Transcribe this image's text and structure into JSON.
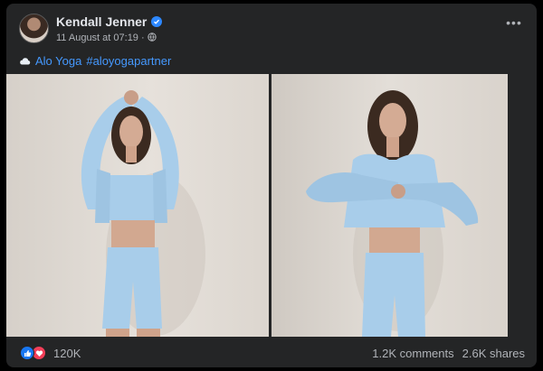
{
  "post": {
    "author": "Kendall Jenner",
    "timestamp": "11 August at 07:19",
    "separator": "·",
    "more_label": "•••",
    "caption_brand": "Alo Yoga",
    "caption_hashtag": "#aloyogapartner",
    "photos": [
      {
        "icon": "photo-left",
        "description_alt": ""
      },
      {
        "icon": "photo-right",
        "description_alt": ""
      }
    ],
    "reaction_count": "120K",
    "comments": "1.2K comments",
    "shares": "2.6K shares"
  },
  "colors": {
    "card_bg": "#242526",
    "link": "#4599ff",
    "like_blue": "#1877f2",
    "love_red": "#f33e58",
    "verified": "#2d88ff",
    "outfit": "#a8cdea"
  }
}
